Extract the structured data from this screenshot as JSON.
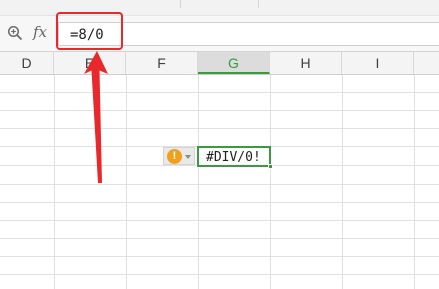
{
  "formula_bar": {
    "zoom_icon": "zoom-search-icon",
    "fx_label": "fx",
    "formula": "=8/0"
  },
  "columns": [
    {
      "label": "D",
      "selected": false
    },
    {
      "label": "E",
      "selected": false
    },
    {
      "label": "F",
      "selected": false
    },
    {
      "label": "G",
      "selected": true
    },
    {
      "label": "H",
      "selected": false
    },
    {
      "label": "I",
      "selected": false
    }
  ],
  "active_cell": {
    "column": "G",
    "value": "#DIV/0!"
  },
  "error_indicator": {
    "icon": "warning-icon",
    "symbol": "!",
    "menu_icon": "chevron-down-icon"
  },
  "annotation": {
    "highlight_color": "#e8282b",
    "arrow_color": "#e8282b"
  },
  "colors": {
    "selection_green": "#3b9a3e",
    "warning_orange": "#f0a01c"
  }
}
